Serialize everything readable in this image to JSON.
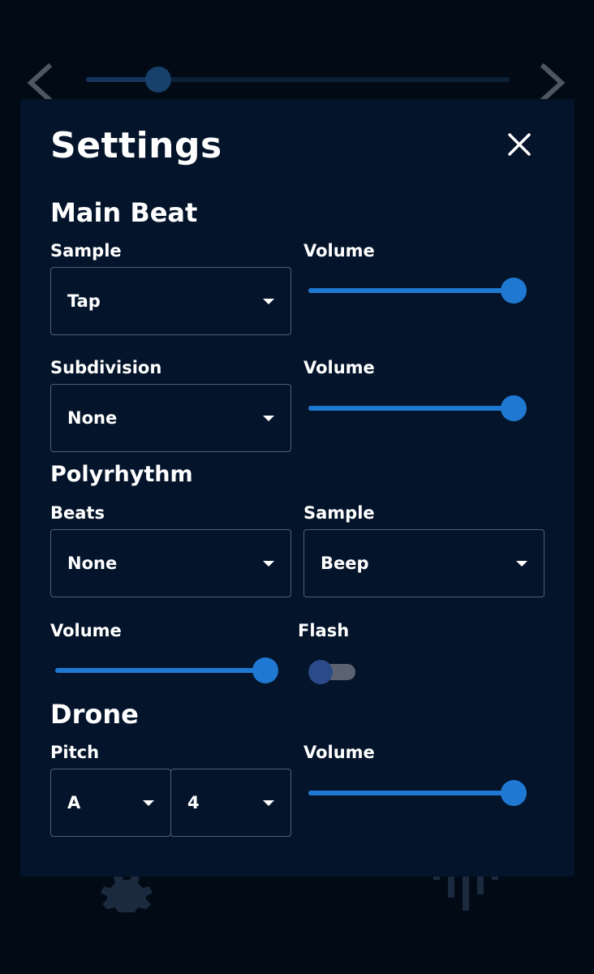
{
  "background": {
    "top_slider": {
      "value": 0.17
    },
    "icons": [
      "chevron-left-icon",
      "chevron-right-icon",
      "gear-icon",
      "levels-icon"
    ]
  },
  "settings": {
    "title": "Settings",
    "close_icon": "close-icon",
    "main_beat": {
      "heading": "Main Beat",
      "sample_label": "Sample",
      "sample_value": "Tap",
      "sample_volume_label": "Volume",
      "sample_volume": 1.0,
      "subdivision_label": "Subdivision",
      "subdivision_value": "None",
      "subdivision_volume_label": "Volume",
      "subdivision_volume": 1.0
    },
    "polyrhythm": {
      "heading": "Polyrhythm",
      "beats_label": "Beats",
      "beats_value": "None",
      "sample_label": "Sample",
      "sample_value": "Beep",
      "volume_label": "Volume",
      "volume": 1.0,
      "flash_label": "Flash",
      "flash_on": false
    },
    "drone": {
      "heading": "Drone",
      "pitch_label": "Pitch",
      "pitch_note": "A",
      "pitch_octave": "4",
      "volume_label": "Volume",
      "volume": 1.0
    }
  },
  "colors": {
    "accent": "#1f78d1",
    "panel": "#04142a",
    "background": "#020a15"
  }
}
